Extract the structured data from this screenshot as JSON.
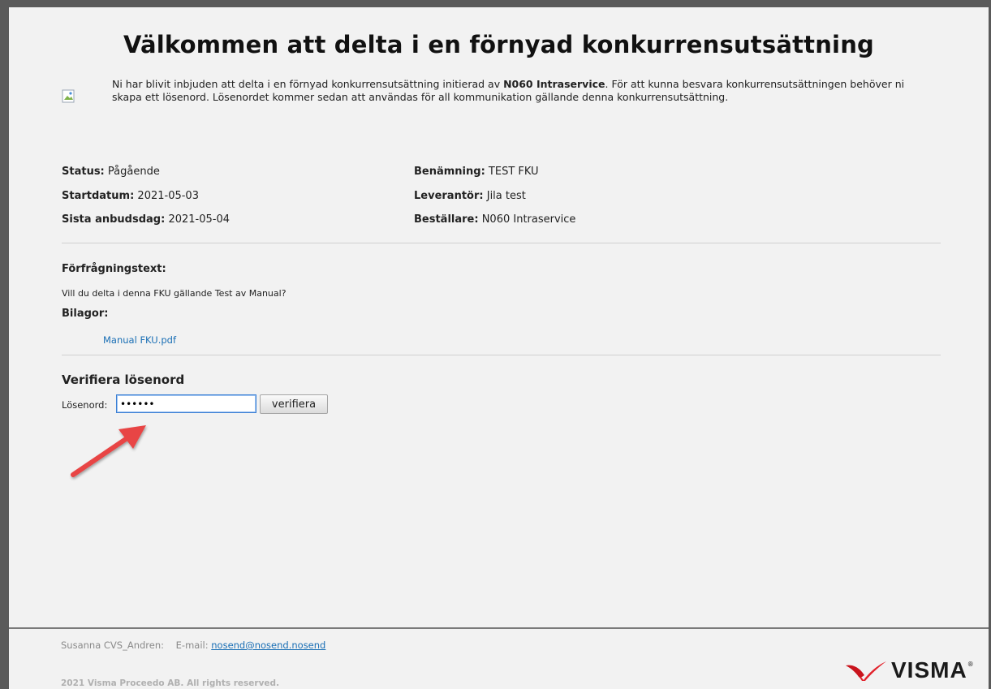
{
  "page": {
    "title": "Välkommen att delta i en förnyad konkurrensutsättning",
    "intro_before": "Ni har blivit inbjuden att delta i en förnyad konkurrensutsättning initierad av ",
    "intro_org": "N060 Intraservice",
    "intro_after": ". För att kunna besvara konkurrensutsättningen behöver ni skapa ett lösenord. Lösenordet kommer sedan att användas för all kommunikation gällande denna konkurrensutsättning."
  },
  "details": {
    "status_label": "Status:",
    "status_value": "Pågående",
    "start_label": "Startdatum:",
    "start_value": "2021-05-03",
    "last_label": "Sista anbudsdag:",
    "last_value": "2021-05-04",
    "name_label": "Benämning:",
    "name_value": "TEST FKU",
    "supplier_label": "Leverantör:",
    "supplier_value": "Jila test",
    "orderer_label": "Beställare:",
    "orderer_value": "N060 Intraservice"
  },
  "request": {
    "heading": "Förfrågningstext:",
    "text": "Vill du delta i denna FKU gällande Test av Manual?",
    "attachments_heading": "Bilagor:",
    "attachment": "Manual FKU.pdf"
  },
  "verify": {
    "heading": "Verifiera lösenord",
    "password_label": "Lösenord:",
    "password_value": "••••••",
    "button": "verifiera"
  },
  "footer": {
    "contact_name": "Susanna CVS_Andren:",
    "email_label": "E-mail:",
    "email": "nosend@nosend.nosend",
    "copyright": "2021 Visma Proceedo AB. All rights reserved.",
    "logo_text": "VISMA",
    "logo_reg": "®"
  },
  "colors": {
    "link": "#1a6fb5",
    "arrow": "#e84545",
    "logo_red": "#e2222b"
  }
}
